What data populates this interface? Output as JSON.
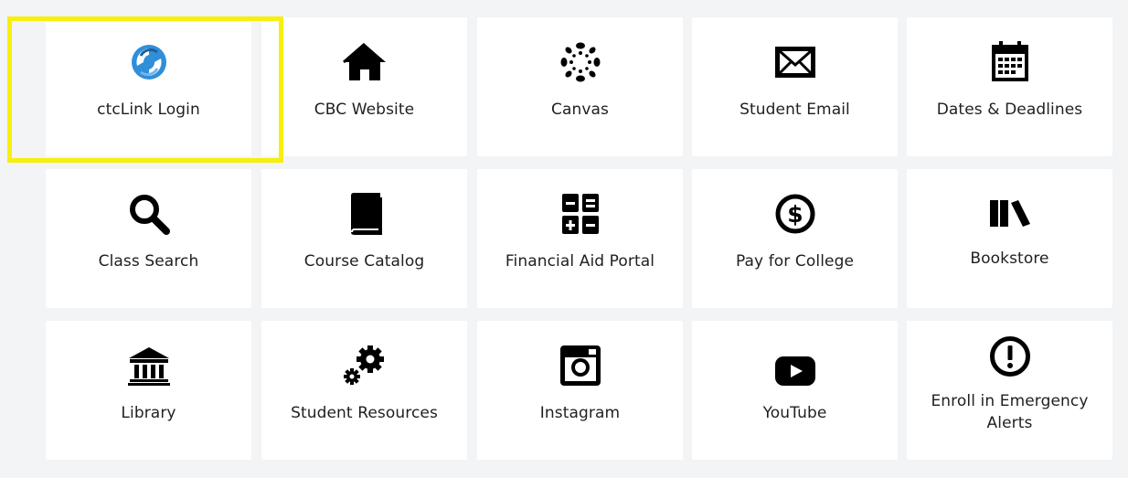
{
  "highlight_color": "#f7ef0c",
  "tiles": [
    {
      "label": "ctcLink Login",
      "icon": "ctclink-logo-icon"
    },
    {
      "label": "CBC Website",
      "icon": "home-icon"
    },
    {
      "label": "Canvas",
      "icon": "canvas-logo-icon"
    },
    {
      "label": "Student Email",
      "icon": "envelope-icon"
    },
    {
      "label": "Dates & Deadlines",
      "icon": "calendar-icon"
    },
    {
      "label": "Class Search",
      "icon": "search-icon"
    },
    {
      "label": "Course Catalog",
      "icon": "book-icon"
    },
    {
      "label": "Financial Aid Portal",
      "icon": "calculator-icon"
    },
    {
      "label": "Pay for College",
      "icon": "dollar-circle-icon"
    },
    {
      "label": "Bookstore",
      "icon": "books-icon"
    },
    {
      "label": "Library",
      "icon": "library-building-icon"
    },
    {
      "label": "Student Resources",
      "icon": "gears-icon"
    },
    {
      "label": "Instagram",
      "icon": "instagram-icon"
    },
    {
      "label": "YouTube",
      "icon": "youtube-icon"
    },
    {
      "label": "Enroll in Emergency Alerts",
      "icon": "exclamation-circle-icon"
    }
  ]
}
